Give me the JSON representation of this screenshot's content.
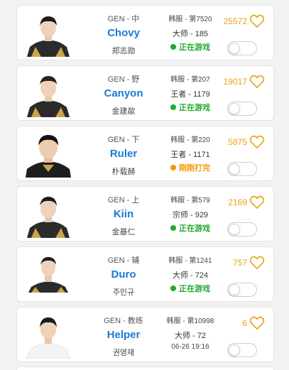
{
  "players": [
    {
      "team_role": "GEN - 中",
      "nickname": "Chovy",
      "real_name": "郑志勋",
      "server_rank": "韩服 - 第7520",
      "tier": "大师 - 185",
      "status": "正在游戏",
      "status_type": "online",
      "likes": "25572",
      "following": false
    },
    {
      "team_role": "GEN - 野",
      "nickname": "Canyon",
      "real_name": "金建歘",
      "server_rank": "韩服 - 第207",
      "tier": "王者 - 1179",
      "status": "正在游戏",
      "status_type": "online",
      "likes": "19017",
      "following": false
    },
    {
      "team_role": "GEN - 下",
      "nickname": "Ruler",
      "real_name": "朴载赫",
      "server_rank": "韩服 - 第220",
      "tier": "王者 - 1171",
      "status": "刚刚打完",
      "status_type": "done",
      "likes": "5875",
      "following": false
    },
    {
      "team_role": "GEN - 上",
      "nickname": "Kiin",
      "real_name": "金基仁",
      "server_rank": "韩服 - 第579",
      "tier": "宗师 - 929",
      "status": "正在游戏",
      "status_type": "online",
      "likes": "2169",
      "following": false
    },
    {
      "team_role": "GEN - 辅",
      "nickname": "Duro",
      "real_name": "주민규",
      "server_rank": "韩服 - 第1241",
      "tier": "大师 - 724",
      "status": "正在游戏",
      "status_type": "online",
      "likes": "757",
      "following": false
    },
    {
      "team_role": "GEN - 教练",
      "nickname": "Helper",
      "real_name": "권영재",
      "server_rank": "韩服 - 第10998",
      "tier": "大师 - 72",
      "status": "06-26 19:16",
      "status_type": "time",
      "likes": "6",
      "following": false
    }
  ],
  "colors": {
    "nickname": "#1a7ad6",
    "online": "#22a82e",
    "just_finished": "#f09a00",
    "likes": "#e8a21a",
    "heart_outline": "#e8a21a"
  },
  "icons": {
    "like": "heart-outline-icon",
    "status": "status-dot-icon",
    "avatar": "player-photo"
  }
}
